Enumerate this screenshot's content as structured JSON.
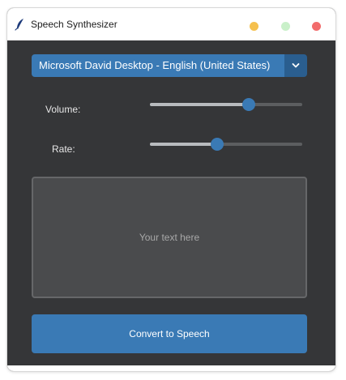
{
  "window": {
    "title": "Speech Synthesizer",
    "controls": {
      "minimize": {
        "icon": "minimize-dot",
        "color": "#f5c04e"
      },
      "maximize": {
        "icon": "maximize-dot",
        "color": "#c9f0c9"
      },
      "close": {
        "icon": "close-dot",
        "color": "#f26c6c"
      }
    },
    "app_icon": "feather-icon"
  },
  "voice": {
    "selected": "Microsoft David Desktop - English (United States)",
    "dropdown_icon": "chevron-down-icon"
  },
  "volume": {
    "label": "Volume:",
    "value_fraction": 0.65
  },
  "rate": {
    "label": "Rate:",
    "value_fraction": 0.44
  },
  "text_input": {
    "placeholder": "Your text here",
    "value": ""
  },
  "convert_button": {
    "label": "Convert to Speech"
  },
  "colors": {
    "accent": "#3a7ab5",
    "accent_dark": "#2a5e8f",
    "background": "#353638",
    "track": "#5c5e60",
    "track_fill": "#b8bbbe"
  }
}
